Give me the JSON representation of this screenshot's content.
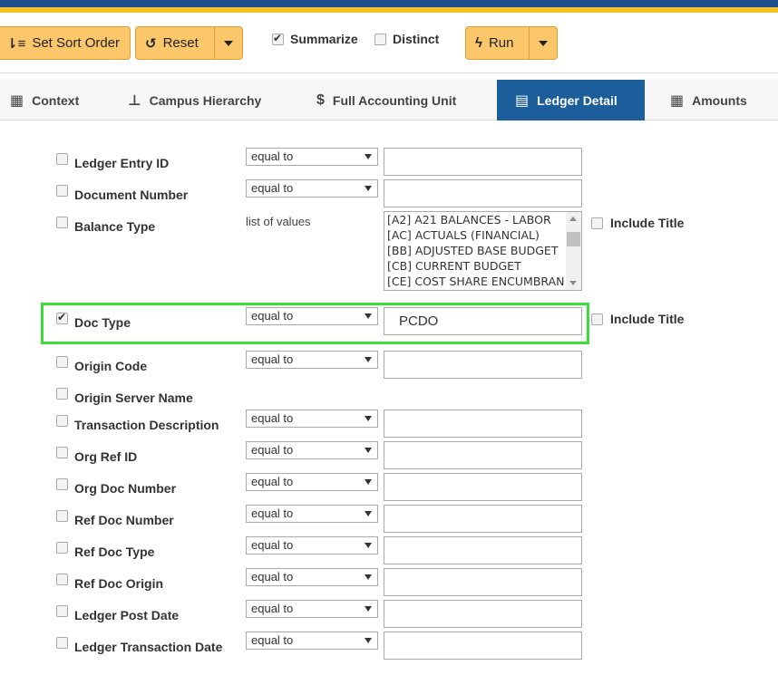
{
  "toolbar": {
    "sort_label": "Set Sort Order",
    "reset_label": "Reset",
    "summarize_label": "Summarize",
    "summarize_checked": true,
    "distinct_label": "Distinct",
    "distinct_checked": false,
    "run_label": "Run"
  },
  "tabs": [
    {
      "label": "Context",
      "icon": "calendar-icon"
    },
    {
      "label": "Campus Hierarchy",
      "icon": "sitemap-icon"
    },
    {
      "label": "Full Accounting Unit",
      "icon": "dollar-icon"
    },
    {
      "label": "Ledger Detail",
      "icon": "book-icon",
      "active": true
    },
    {
      "label": "Amounts",
      "icon": "calculator-icon"
    }
  ],
  "fields": {
    "ledger_entry_id": {
      "label": "Ledger Entry ID",
      "operator": "equal to",
      "value": ""
    },
    "document_number": {
      "label": "Document Number",
      "operator": "equal to",
      "value": ""
    },
    "balance_type": {
      "label": "Balance Type",
      "operator": "list of values",
      "options": [
        "[A2] A21 BALANCES - LABOR",
        "[AC] ACTUALS (FINANCIAL)",
        "[BB] ADJUSTED BASE BUDGET",
        "[CB] CURRENT BUDGET",
        "[CE] COST SHARE ENCUMBRANCE"
      ],
      "include_title": "Include Title"
    },
    "doc_type": {
      "label": "Doc Type",
      "operator": "equal to",
      "value": "PCDO",
      "checked": true,
      "include_title": "Include Title"
    },
    "origin_code": {
      "label": "Origin Code",
      "operator": "equal to",
      "value": ""
    },
    "origin_server_name": {
      "label": "Origin Server Name"
    },
    "transaction_description": {
      "label": "Transaction Description",
      "operator": "equal to",
      "value": ""
    },
    "org_ref_id": {
      "label": "Org Ref ID",
      "operator": "equal to",
      "value": ""
    },
    "org_doc_number": {
      "label": "Org Doc Number",
      "operator": "equal to",
      "value": ""
    },
    "ref_doc_number": {
      "label": "Ref Doc Number",
      "operator": "equal to",
      "value": ""
    },
    "ref_doc_type": {
      "label": "Ref Doc Type",
      "operator": "equal to",
      "value": ""
    },
    "ref_doc_origin": {
      "label": "Ref Doc Origin",
      "operator": "equal to",
      "value": ""
    },
    "ledger_post_date": {
      "label": "Ledger Post Date",
      "operator": "equal to",
      "value": ""
    },
    "ledger_transaction_date": {
      "label": "Ledger Transaction Date",
      "operator": "equal to",
      "value": ""
    }
  },
  "colors": {
    "accent": "#fbc76a",
    "active_tab": "#1c5d9b",
    "highlight": "#3adf3a",
    "brand_blue": "#1a4f8a",
    "brand_gold": "#f3c224"
  }
}
